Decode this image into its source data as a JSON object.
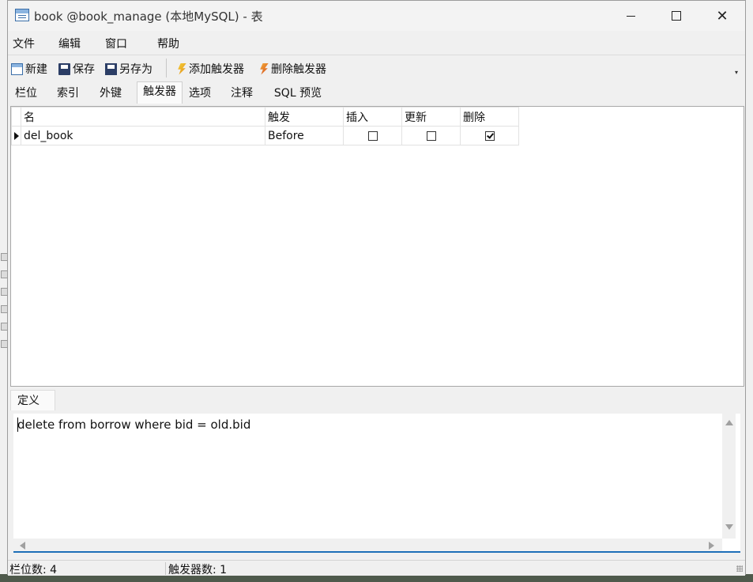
{
  "window": {
    "title": "book @book_manage (本地MySQL) - 表"
  },
  "menu": [
    "文件",
    "编辑",
    "窗口",
    "帮助"
  ],
  "toolbar": {
    "new_label": "新建",
    "save_label": "保存",
    "saveas_label": "另存为",
    "add_trigger_label": "添加触发器",
    "delete_trigger_label": "删除触发器"
  },
  "tabs": [
    "栏位",
    "索引",
    "外键",
    "触发器",
    "选项",
    "注释",
    "SQL 预览"
  ],
  "active_tab": "触发器",
  "grid": {
    "headers": {
      "name": "名",
      "fire": "触发",
      "insert": "插入",
      "update": "更新",
      "delete": "删除"
    },
    "rows": [
      {
        "name": "del_book",
        "fire": "Before",
        "insert": false,
        "update": false,
        "delete": true
      }
    ]
  },
  "definition": {
    "tab_label": "定义",
    "text": "delete from borrow where bid = old.bid"
  },
  "status": {
    "fields_count": "栏位数: 4",
    "triggers_count": "触发器数: 1"
  }
}
